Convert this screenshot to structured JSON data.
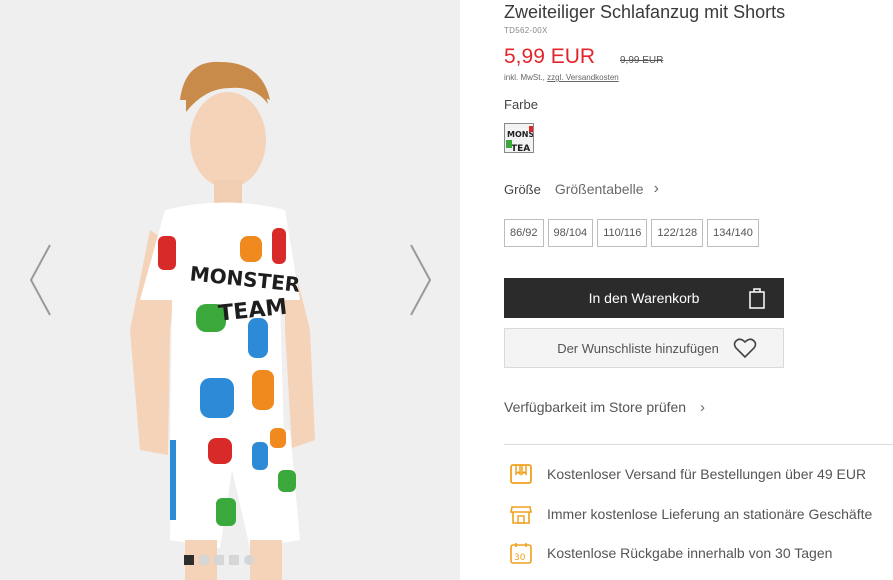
{
  "product": {
    "title": "Zweiteiliger Schlafanzug mit Shorts",
    "sku": "TD562-00X",
    "price": "5,99 EUR",
    "old_price": "9,99 EUR",
    "tax_note": "inkl. MwSt.,",
    "shipping_link": "zzgl. Versandkosten"
  },
  "gallery": {
    "image_count": 5,
    "active_index": 0
  },
  "color": {
    "label": "Farbe"
  },
  "size": {
    "label": "Größe",
    "chart_link": "Größentabelle",
    "options": [
      "86/92",
      "98/104",
      "110/116",
      "122/128",
      "134/140"
    ]
  },
  "actions": {
    "add_to_cart": "In den Warenkorb",
    "add_to_wishlist": "Der Wunschliste hinzufügen",
    "store_availability": "Verfügbarkeit im Store prüfen"
  },
  "benefits": [
    {
      "icon": "delivery-truck-icon",
      "text": "Kostenloser Versand für Bestellungen über 49 EUR"
    },
    {
      "icon": "store-icon",
      "text": "Immer kostenlose Lieferung an stationäre Geschäfte"
    },
    {
      "icon": "return-30-days-icon",
      "text": "Kostenlose Rückgabe innerhalb von 30 Tagen"
    }
  ],
  "colors": {
    "price_red": "#e3262d",
    "button_dark": "#2b2b2b",
    "accent_orange": "#f0a01e"
  }
}
